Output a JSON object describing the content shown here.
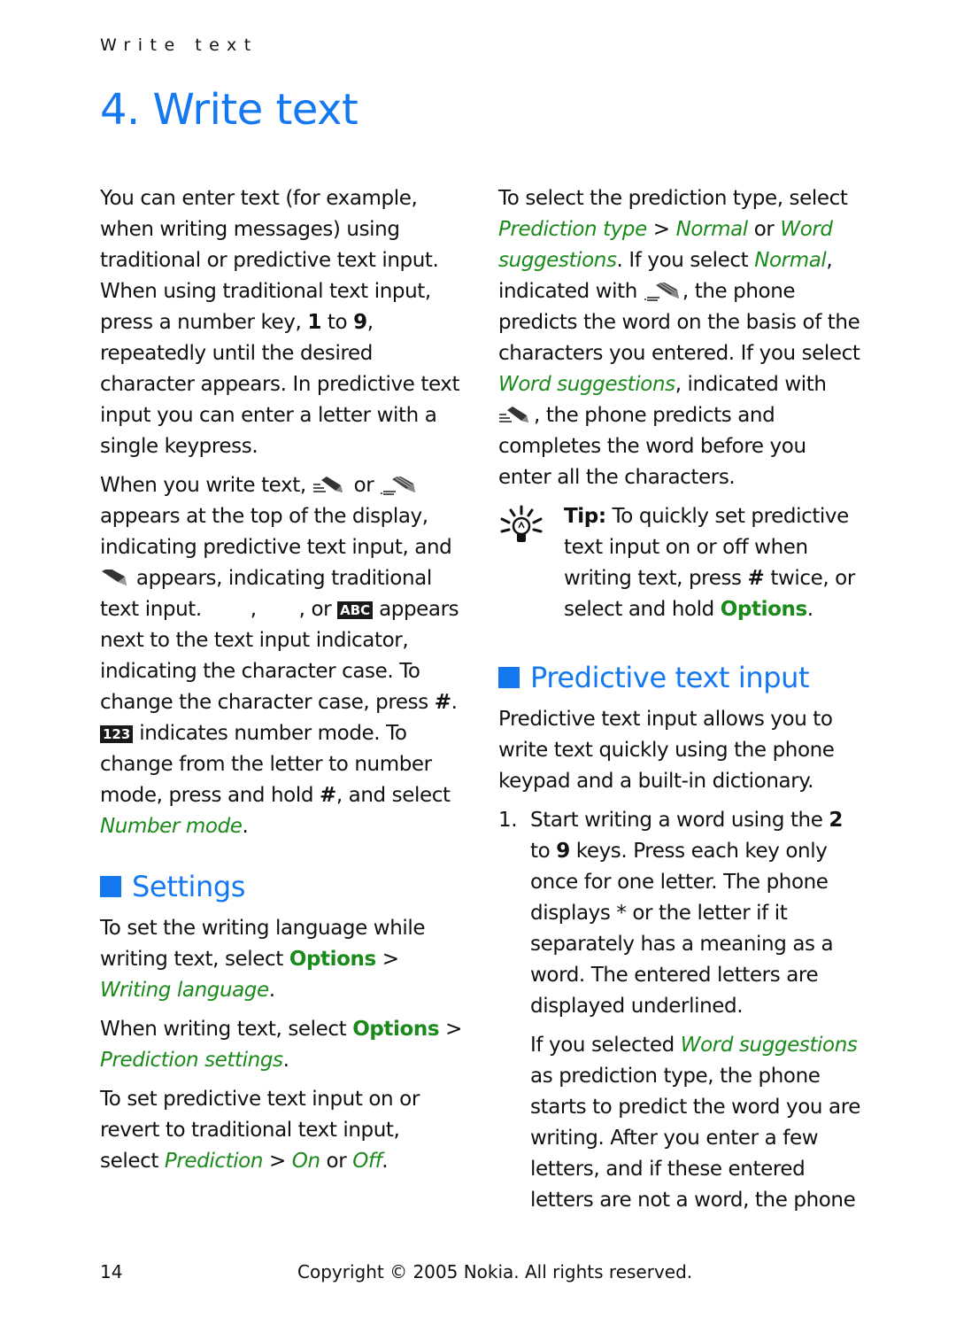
{
  "running_head": "Write text",
  "chapter_title": "4. Write text",
  "left": {
    "p1": "You can enter text (for example, when writing messages) using traditional or predictive text input. When using traditional text input, press a number key, ",
    "p1_k1": "1",
    "p1_to": " to ",
    "p1_k2": "9",
    "p1_end": ", repeatedly until the desired character appears. In predictive text input you can enter a letter with a single keypress.",
    "p2_a": "When you write text, ",
    "p2_or": " or ",
    "p2_b": " appears at the top of the display, indicating predictive text input, and ",
    "p2_c": " appears, indicating traditional text input. ",
    "p2_comma": ",",
    "p2_or2": ", or ",
    "badge_abc": "ABC",
    "p2_d": " appears next to the text input indicator, indicating the character case. To change the character case, press ",
    "hash": "#",
    "p2_e": ". ",
    "badge_123": "123",
    "p2_f": " indicates number mode. To change from the letter to number mode, press and hold ",
    "p2_g": ", and select ",
    "number_mode": "Number mode",
    "period": ".",
    "settings_heading": "Settings",
    "s1_a": "To set the writing language while writing text, select ",
    "options": "Options",
    "gt": " > ",
    "writing_language": "Writing language",
    "s2_a": "When writing text, select ",
    "prediction_settings": "Prediction settings",
    "s3_a": "To set predictive text input on or revert to traditional text input, select ",
    "prediction": "Prediction",
    "on": "On",
    "or": " or ",
    "off": "Off"
  },
  "right": {
    "r1_a": "To select the prediction type, select ",
    "prediction_type": "Prediction type",
    "gt": " > ",
    "normal": "Normal",
    "or": " or ",
    "word_suggestions": "Word suggestions",
    "r1_b": ". If you select ",
    "r1_c": ", indicated with ",
    "r1_d": ", the phone predicts the word on the basis of the characters you entered. If you select ",
    "r1_e": ", indicated with ",
    "r1_f": ", the phone predicts and completes the word before you enter all the characters.",
    "tip_label": "Tip:",
    "tip_a": " To quickly set predictive text input on or off when writing text, press ",
    "hash": "#",
    "tip_b": " twice, or select and hold ",
    "options": "Options",
    "period": ".",
    "predictive_heading": "Predictive text input",
    "pti_intro": "Predictive text input allows you to write text quickly using the phone keypad and a built-in dictionary.",
    "step1_num": "1.",
    "step1_a": "Start writing a word using the ",
    "k2": "2",
    "to": " to ",
    "k9": "9",
    "step1_b": " keys. Press each key only once for one letter. The phone displays * or the letter if it separately has a meaning as a word. The entered letters are displayed underlined.",
    "step1_c": "If you selected ",
    "step1_d": " as prediction type, the phone starts to predict the word you are writing. After you enter a few letters, and if these entered letters are not a word, the phone"
  },
  "footer": {
    "page_number": "14",
    "copyright": "Copyright © 2005 Nokia. All rights reserved."
  }
}
